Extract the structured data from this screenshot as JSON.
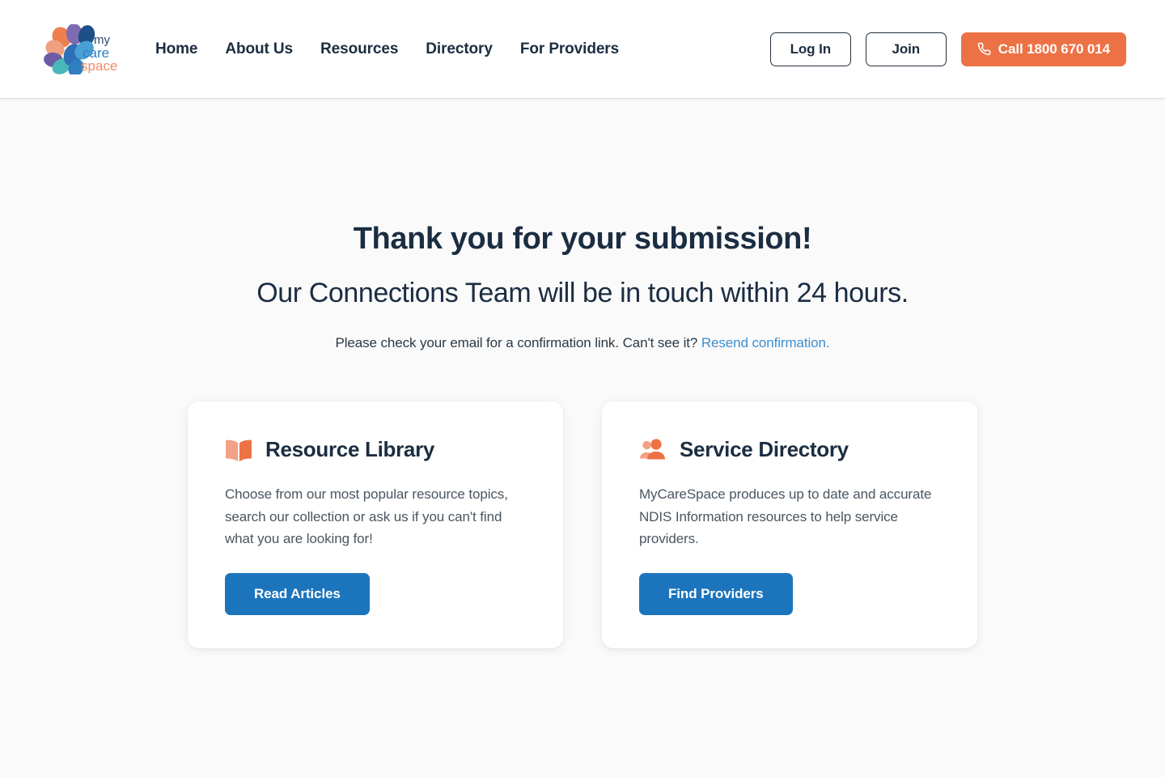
{
  "brand": {
    "logo_text_line1": "my",
    "logo_text_line2": "care",
    "logo_text_line3": "space",
    "logo_colors": {
      "my": "#2b4a6f",
      "care": "#2f7fc1",
      "space": "#ef8a68",
      "petal_orange": "#ef7f4e",
      "petal_salmon": "#f0a07e",
      "petal_purple": "#6b5ca5",
      "petal_violet": "#7e6bb3",
      "petal_blue": "#2f6fb5",
      "petal_navy": "#1f4f87",
      "petal_teal": "#49b7b8",
      "petal_lightblue": "#4a9fd4"
    }
  },
  "header": {
    "nav": [
      {
        "label": "Home"
      },
      {
        "label": "About Us"
      },
      {
        "label": "Resources"
      },
      {
        "label": "Directory"
      },
      {
        "label": "For Providers"
      }
    ],
    "login_label": "Log In",
    "join_label": "Join",
    "call_label": "Call 1800 670 014",
    "call_icon": "phone-icon",
    "call_bg": "#ec7246"
  },
  "main": {
    "headline": "Thank you for your submission!",
    "subheadline": "Our Connections Team will be in touch within 24 hours.",
    "confirm_text": "Please check your email for a confirmation link. Can't see it?",
    "confirm_link_label": "Resend confirmation.",
    "link_color": "#3d8fd1",
    "heading_color": "#1b2d41"
  },
  "cards": [
    {
      "icon": "open-book-icon",
      "title": "Resource Library",
      "body": "Choose from our most popular resource topics, search our collection or ask us if you can't find what you are looking for!",
      "button_label": "Read Articles",
      "button_color": "#1c75bc",
      "icon_color_light": "#f2a184",
      "icon_color_dark": "#ed7344"
    },
    {
      "icon": "users-group-icon",
      "title": "Service Directory",
      "body": "MyCareSpace produces up to date and accurate NDIS Information resources to help service providers.",
      "button_label": "Find Providers",
      "button_color": "#1c75bc",
      "icon_color_light": "#f2a184",
      "icon_color_dark": "#ed7344"
    }
  ]
}
